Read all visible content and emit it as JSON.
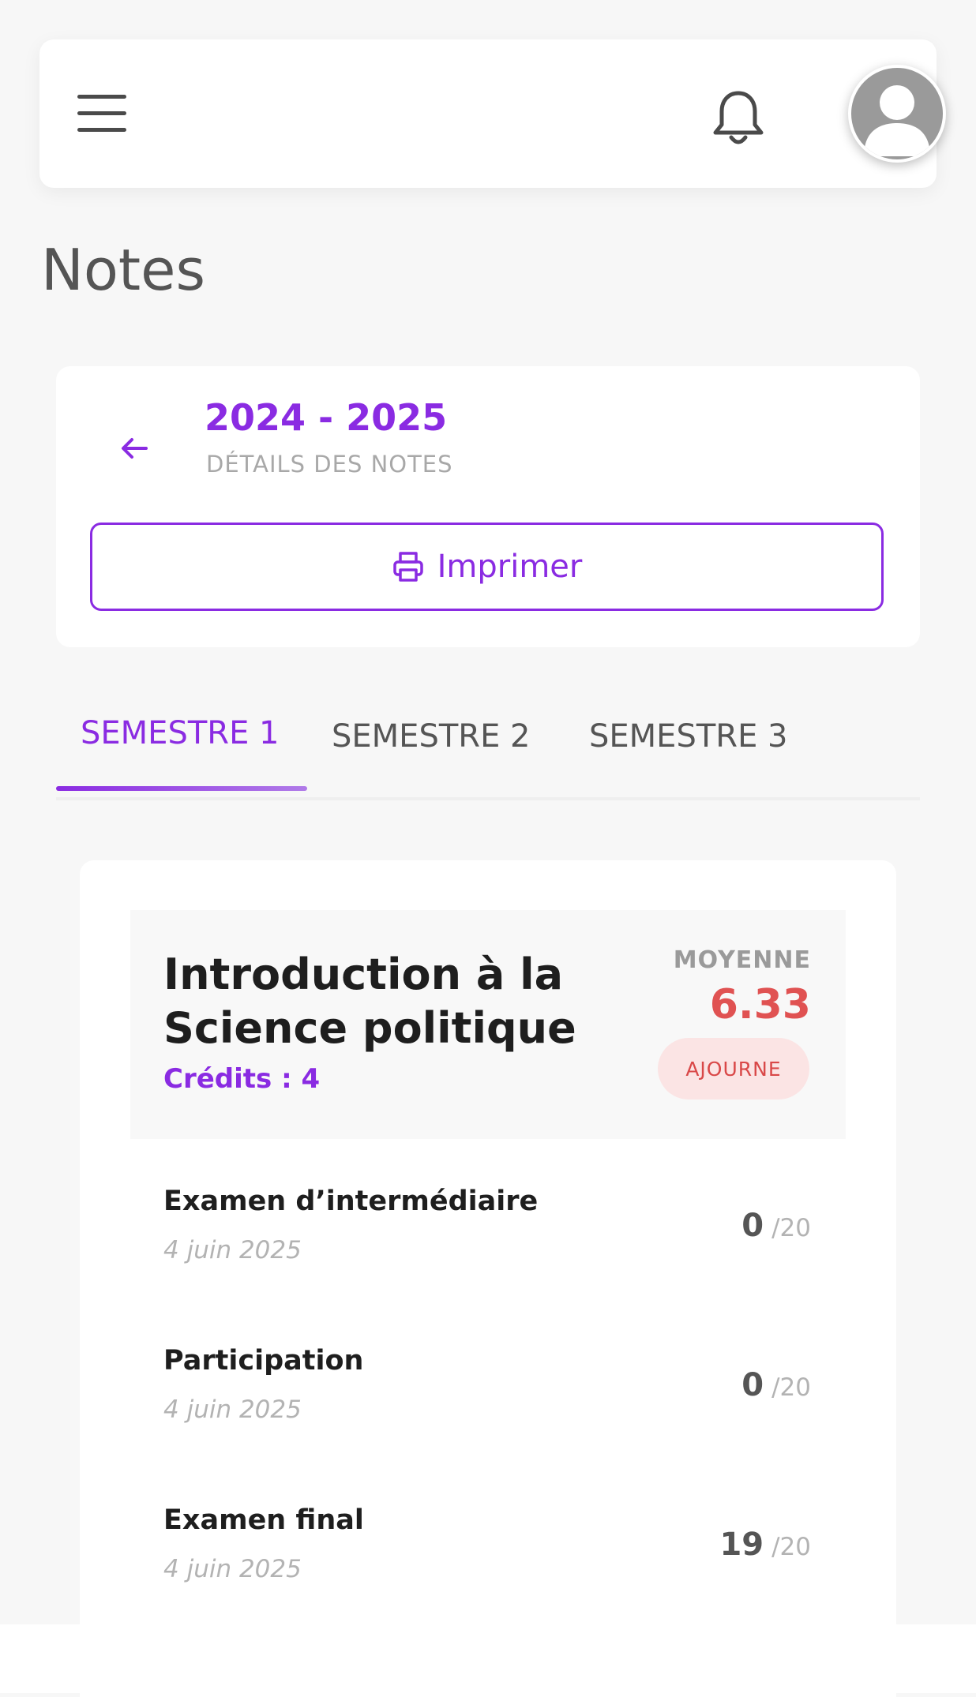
{
  "header": {
    "menu_icon": "hamburger-menu-icon",
    "notification_icon": "bell-icon",
    "avatar_icon": "user-avatar-icon"
  },
  "page": {
    "title": "Notes"
  },
  "year_card": {
    "back_icon": "arrow-left-icon",
    "year": "2024 - 2025",
    "subtitle": "DÉTAILS DES NOTES",
    "print_icon": "printer-icon",
    "print_label": "Imprimer"
  },
  "tabs": [
    {
      "label": "SEMESTRE 1",
      "active": true
    },
    {
      "label": "SEMESTRE 2",
      "active": false
    },
    {
      "label": "SEMESTRE 3",
      "active": false
    }
  ],
  "course": {
    "title_line1": "Introduction à la",
    "title_line2": "Science politique",
    "credits": "Crédits : 4",
    "moyenne_label": "MOYENNE",
    "moyenne_value": "6.33",
    "status": "AJOURNE",
    "grades": [
      {
        "name": "Examen d’intermédiaire",
        "date": "4 juin 2025",
        "value": "0",
        "max": "/20"
      },
      {
        "name": "Participation",
        "date": "4 juin 2025",
        "value": "0",
        "max": "/20"
      },
      {
        "name": "Examen final",
        "date": "4 juin 2025",
        "value": "19",
        "max": "/20"
      }
    ]
  },
  "colors": {
    "accent": "#8a2be2",
    "danger": "#e05252",
    "danger_bg": "#fbe4e4"
  }
}
